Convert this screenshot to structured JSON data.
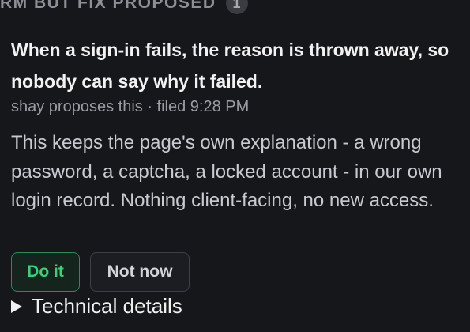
{
  "section": {
    "label": "RM BUT FIX PROPOSED",
    "count": "1"
  },
  "proposal": {
    "title": "When a sign-in fails, the reason is thrown away, so nobody can say why it failed.",
    "meta": "shay proposes this · filed 9:28 PM",
    "body": "This keeps the page's own explanation - a wrong password, a captcha, a locked account - in our own login record. Nothing client-facing, no new access.",
    "actions": {
      "accept_label": "Do it",
      "decline_label": "Not now"
    },
    "details_label": "Technical details"
  },
  "colors": {
    "background": "#16171b",
    "accent_green": "#3ecf78",
    "accent_green_border": "#2e8a55"
  },
  "icons": {
    "disclosure": "triangle-right-icon"
  }
}
